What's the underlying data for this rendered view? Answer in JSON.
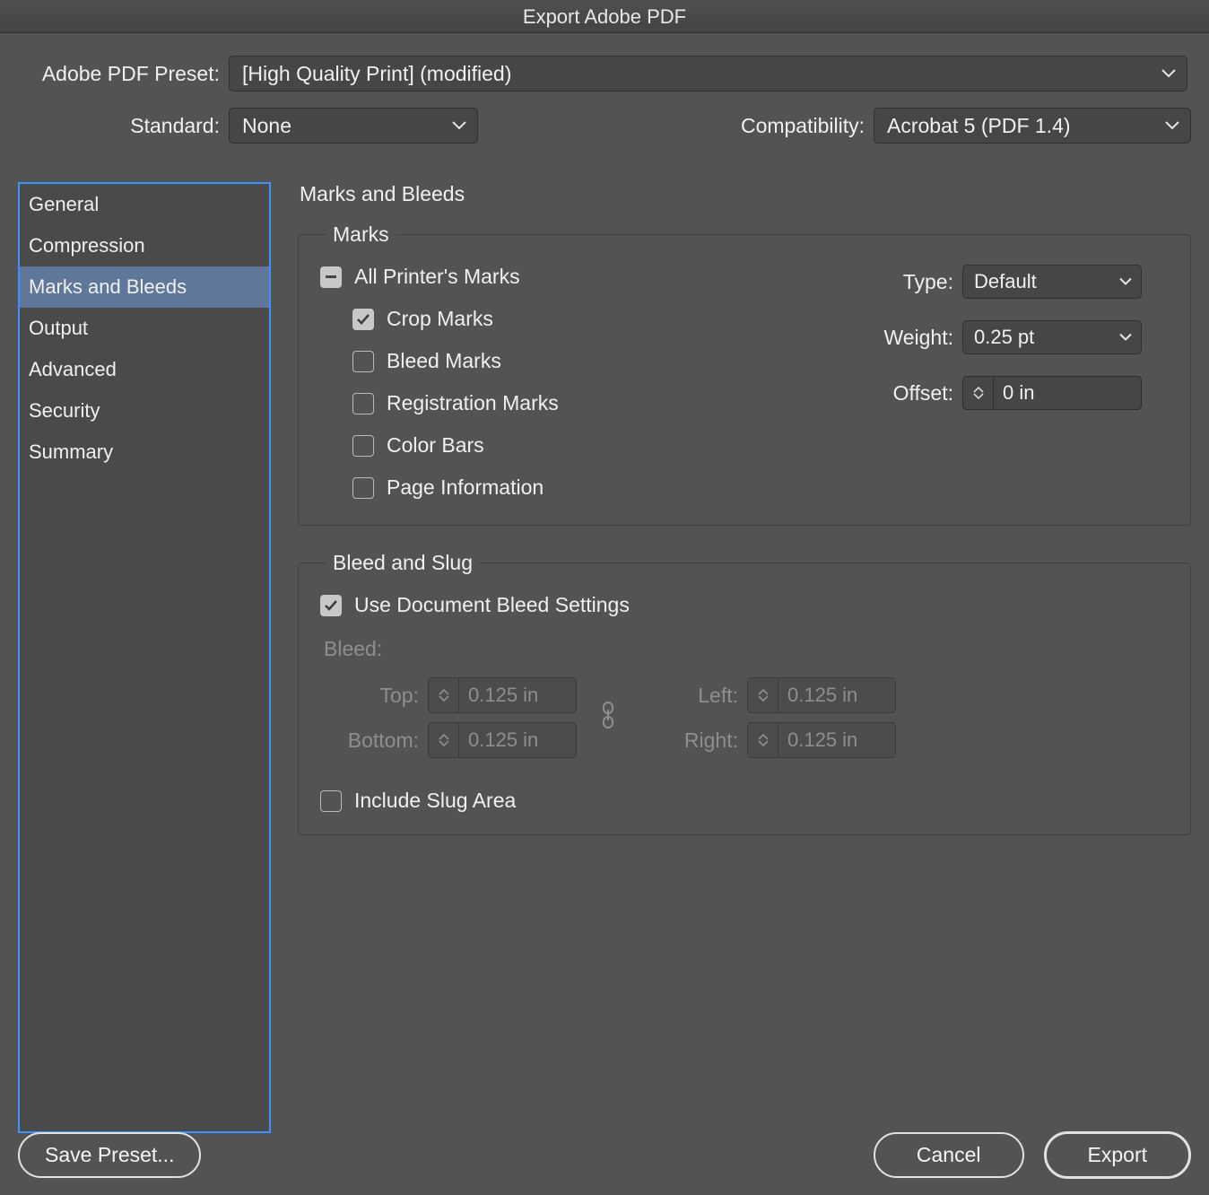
{
  "window": {
    "title": "Export Adobe PDF"
  },
  "top": {
    "presetLabel": "Adobe PDF Preset:",
    "presetValue": "[High Quality Print] (modified)",
    "standardLabel": "Standard:",
    "standardValue": "None",
    "compatLabel": "Compatibility:",
    "compatValue": "Acrobat 5 (PDF 1.4)"
  },
  "sidebar": {
    "items": [
      "General",
      "Compression",
      "Marks and Bleeds",
      "Output",
      "Advanced",
      "Security",
      "Summary"
    ],
    "selectedIndex": 2
  },
  "panel": {
    "title": "Marks and Bleeds",
    "marks": {
      "legend": "Marks",
      "allPrinters": "All Printer's Marks",
      "crop": "Crop Marks",
      "bleedMarks": "Bleed Marks",
      "registration": "Registration Marks",
      "colorBars": "Color Bars",
      "pageInfo": "Page Information",
      "typeLabel": "Type:",
      "typeValue": "Default",
      "weightLabel": "Weight:",
      "weightValue": "0.25 pt",
      "offsetLabel": "Offset:",
      "offsetValue": "0 in"
    },
    "bleed": {
      "legend": "Bleed and Slug",
      "useDoc": "Use Document Bleed Settings",
      "bleedHeading": "Bleed:",
      "topLabel": "Top:",
      "topValue": "0.125 in",
      "bottomLabel": "Bottom:",
      "bottomValue": "0.125 in",
      "leftLabel": "Left:",
      "leftValue": "0.125 in",
      "rightLabel": "Right:",
      "rightValue": "0.125 in",
      "includeSlug": "Include Slug Area"
    }
  },
  "footer": {
    "savePreset": "Save Preset...",
    "cancel": "Cancel",
    "export": "Export"
  }
}
